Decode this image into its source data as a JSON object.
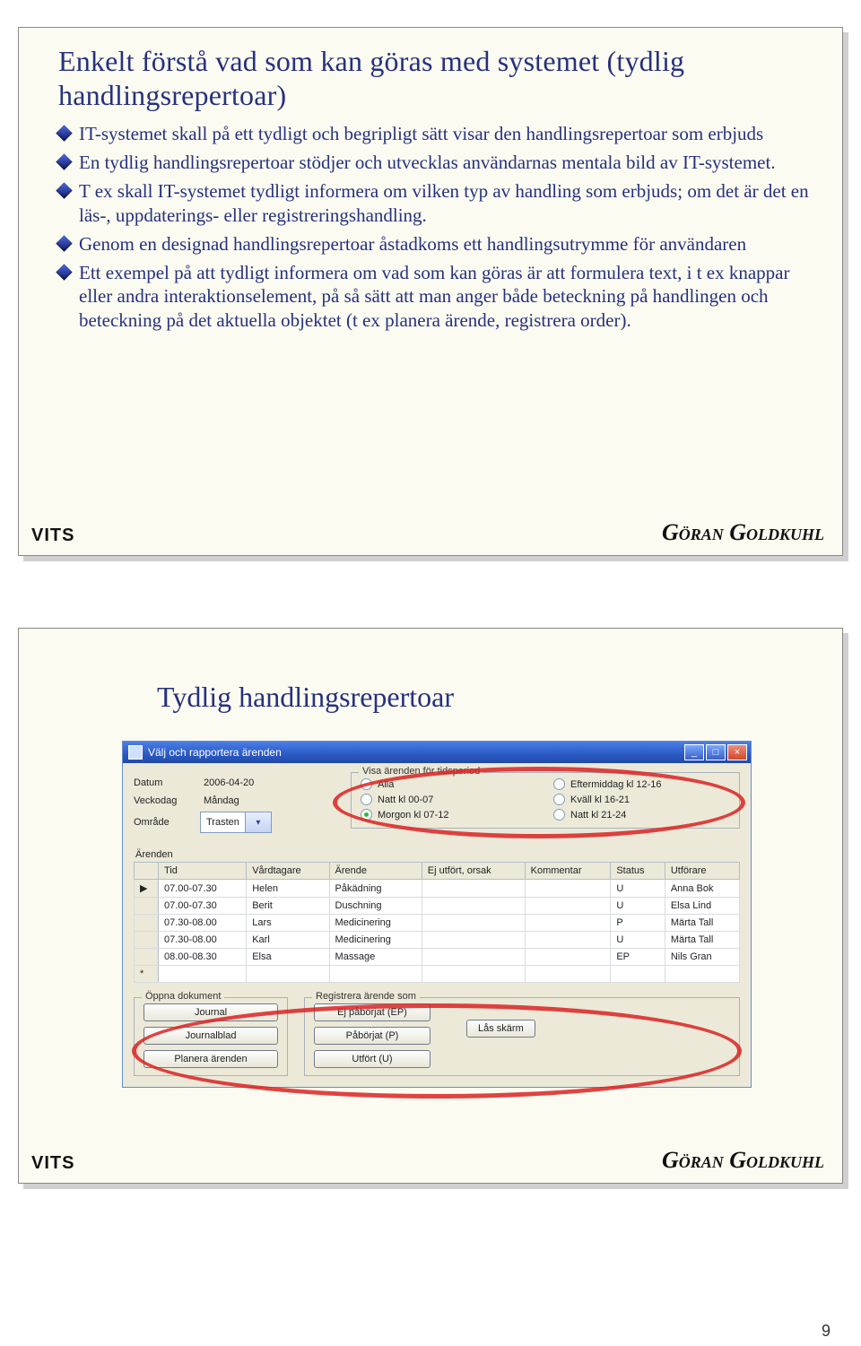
{
  "footer": {
    "org": "VITS",
    "author": "Göran Goldkuhl"
  },
  "page_number": "9",
  "slide1": {
    "title": "Enkelt förstå vad som kan göras med systemet (tydlig handlingsrepertoar)",
    "bullets": [
      "IT-systemet skall på ett tydligt och begripligt sätt visar den handlingsrepertoar som erbjuds",
      "En tydlig handlingsrepertoar stödjer och utvecklas användarnas mentala bild av IT-systemet.",
      "T ex skall IT-systemet tydligt informera om vilken typ av handling som erbjuds; om det är det en läs-, uppdaterings- eller registreringshandling.",
      "Genom en designad handlingsrepertoar åstadkoms ett handlingsutrymme för användaren",
      "Ett exempel på att tydligt informera om vad som kan göras är att formulera text, i t ex knappar eller andra interaktionselement, på så sätt att man anger både beteckning på handlingen och beteckning på det aktuella objektet (t ex planera ärende, registrera order)."
    ]
  },
  "slide2": {
    "title": "Tydlig handlingsrepertoar",
    "app": {
      "window_title": "Välj och rapportera ärenden",
      "labels": {
        "datum": "Datum",
        "veckodag": "Veckodag",
        "omrade": "Område",
        "arenden": "Ärenden"
      },
      "values": {
        "datum": "2006-04-20",
        "veckodag": "Måndag",
        "omrade": "Trasten"
      },
      "period_legend": "Visa ärenden för tidsperiod",
      "radios": [
        {
          "label": "Alla",
          "on": false
        },
        {
          "label": "Eftermiddag kl 12-16",
          "on": false
        },
        {
          "label": "Natt kl 00-07",
          "on": false
        },
        {
          "label": "Kväll kl 16-21",
          "on": false
        },
        {
          "label": "Morgon kl 07-12",
          "on": true
        },
        {
          "label": "Natt kl 21-24",
          "on": false
        }
      ],
      "columns": [
        "Tid",
        "Vårdtagare",
        "Ärende",
        "Ej utfört, orsak",
        "Kommentar",
        "Status",
        "Utförare"
      ],
      "rows": [
        {
          "tid": "07.00-07.30",
          "vard": "Helen",
          "arende": "Påkädning",
          "orsak": "",
          "kom": "",
          "status": "U",
          "utf": "Anna Bok"
        },
        {
          "tid": "07.00-07.30",
          "vard": "Berit",
          "arende": "Duschning",
          "orsak": "",
          "kom": "",
          "status": "U",
          "utf": "Elsa Lind"
        },
        {
          "tid": "07.30-08.00",
          "vard": "Lars",
          "arende": "Medicinering",
          "orsak": "",
          "kom": "",
          "status": "P",
          "utf": "Märta Tall"
        },
        {
          "tid": "07.30-08.00",
          "vard": "Karl",
          "arende": "Medicinering",
          "orsak": "",
          "kom": "",
          "status": "U",
          "utf": "Märta Tall"
        },
        {
          "tid": "08.00-08.30",
          "vard": "Elsa",
          "arende": "Massage",
          "orsak": "",
          "kom": "",
          "status": "EP",
          "utf": "Nils Gran"
        }
      ],
      "open_legend": "Öppna dokument",
      "open_buttons": [
        "Journal",
        "Journalblad",
        "Planera ärenden"
      ],
      "reg_legend": "Registrera ärende som",
      "reg_buttons": [
        "Ej påbörjat (EP)",
        "Påbörjat (P)",
        "Utfört (U)"
      ],
      "lock_button": "Lås skärm"
    }
  }
}
